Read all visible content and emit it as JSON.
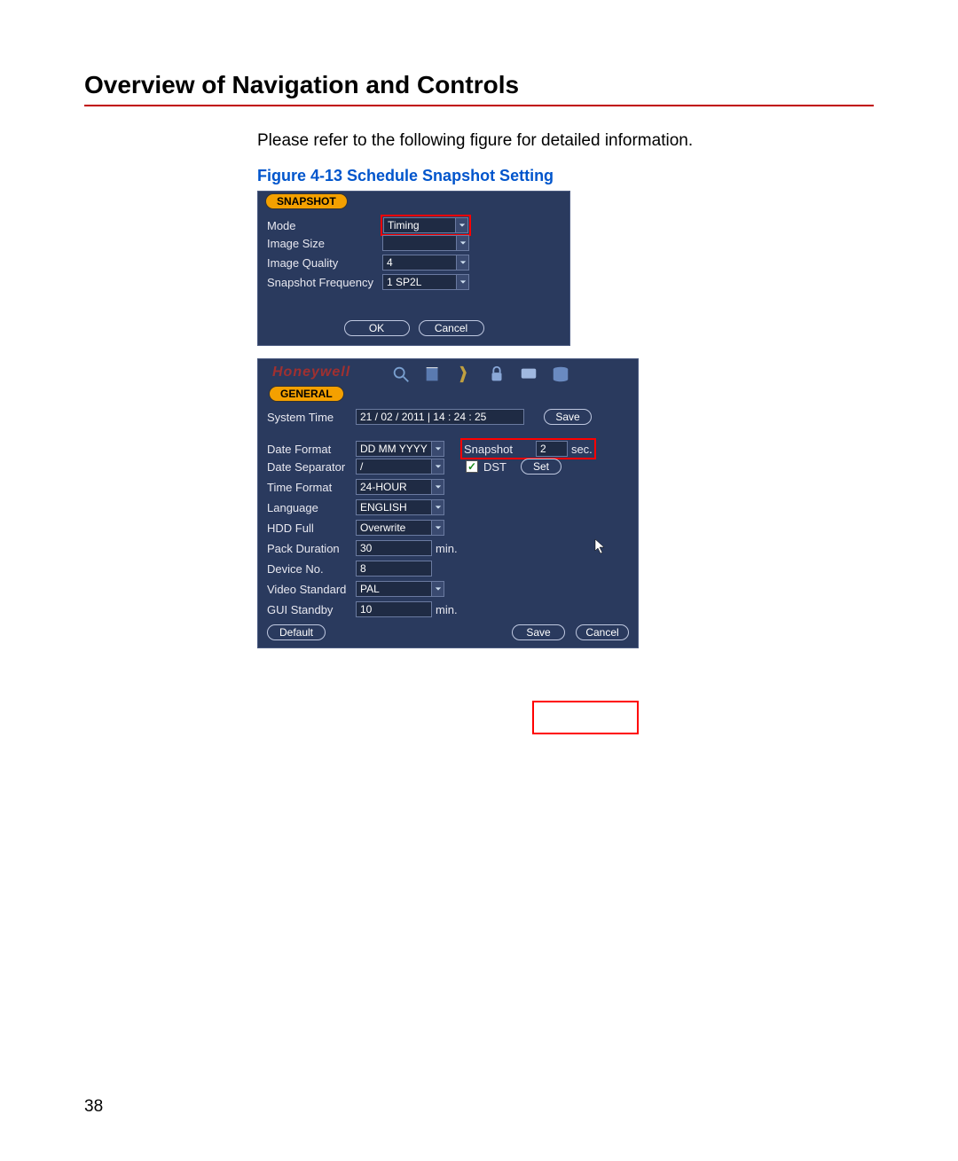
{
  "heading": "Overview of Navigation and Controls",
  "intro_text": "Please refer to the following figure for detailed information.",
  "figure_caption": "Figure 4-13 Schedule Snapshot Setting",
  "page_number": "38",
  "panel1": {
    "tab": "SNAPSHOT",
    "rows": {
      "mode_label": "Mode",
      "mode_value": "Timing",
      "image_size_label": "Image Size",
      "image_size_value": "",
      "image_quality_label": "Image Quality",
      "image_quality_value": "4",
      "snapshot_freq_label": "Snapshot Frequency",
      "snapshot_freq_value": "1 SP2L"
    },
    "buttons": {
      "ok": "OK",
      "cancel": "Cancel"
    }
  },
  "panel2": {
    "brand": "Honeywell",
    "tab": "GENERAL",
    "system_time_label": "System Time",
    "system_time_value": "21 / 02 / 2011   | 14 : 24 : 25",
    "save_btn": "Save",
    "date_format_label": "Date Format",
    "date_format_value": "DD MM YYYY",
    "snapshot_label": "Snapshot",
    "snapshot_value": "2",
    "snapshot_unit": "sec.",
    "date_separator_label": "Date Separator",
    "date_separator_value": "/",
    "dst_label": "DST",
    "set_btn": "Set",
    "time_format_label": "Time Format",
    "time_format_value": "24-HOUR",
    "language_label": "Language",
    "language_value": "ENGLISH",
    "hdd_full_label": "HDD Full",
    "hdd_full_value": "Overwrite",
    "pack_duration_label": "Pack Duration",
    "pack_duration_value": "30",
    "pack_duration_unit": "min.",
    "device_no_label": "Device No.",
    "device_no_value": "8",
    "video_standard_label": "Video Standard",
    "video_standard_value": "PAL",
    "gui_standby_label": "GUI Standby",
    "gui_standby_value": "10",
    "gui_standby_unit": "min.",
    "default_btn": "Default",
    "save_btn2": "Save",
    "cancel_btn": "Cancel"
  }
}
